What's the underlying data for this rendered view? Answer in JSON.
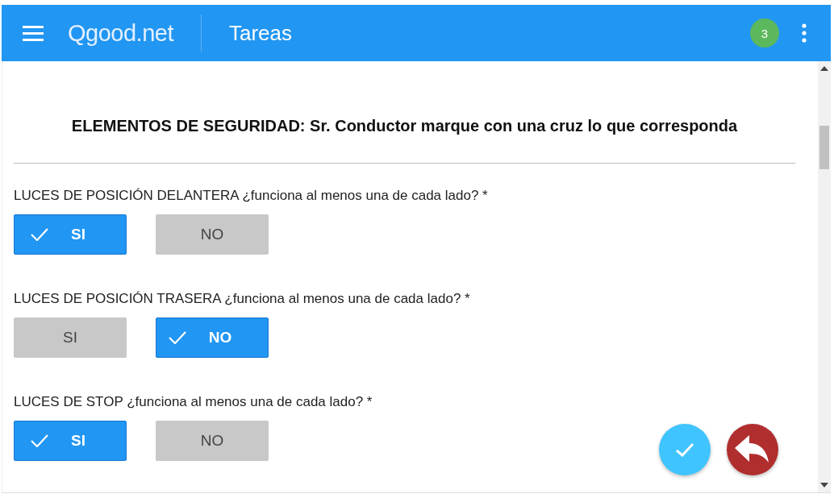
{
  "app_bar": {
    "logo": "Qgood.net",
    "title": "Tareas",
    "badge": "3"
  },
  "section_title": "ELEMENTOS DE SEGURIDAD: Sr. Conductor marque con una cruz lo que corresponda",
  "questions": [
    {
      "label": "LUCES DE POSICIÓN DELANTERA ¿funciona al menos una de cada lado? *",
      "options": [
        {
          "label": "SI",
          "selected": true
        },
        {
          "label": "NO",
          "selected": false
        }
      ]
    },
    {
      "label": "LUCES DE POSICIÓN TRASERA ¿funciona al menos una de cada lado? *",
      "options": [
        {
          "label": "SI",
          "selected": false
        },
        {
          "label": "NO",
          "selected": true
        }
      ]
    },
    {
      "label": "LUCES DE STOP ¿funciona al menos una de cada lado? *",
      "options": [
        {
          "label": "SI",
          "selected": true
        },
        {
          "label": "NO",
          "selected": false
        }
      ]
    }
  ]
}
